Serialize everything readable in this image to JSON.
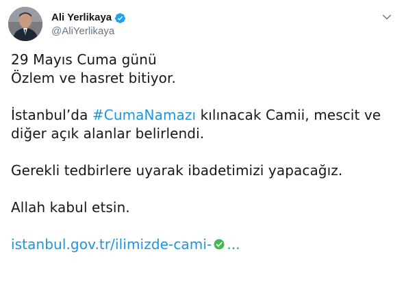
{
  "user": {
    "display_name": "Ali Yerlikaya",
    "handle": "@AliYerlikaya",
    "verified_icon": "verified-badge-icon"
  },
  "tweet": {
    "line1": "29 Mayıs Cuma günü",
    "line2": "Özlem ve hasret bitiyor.",
    "line3_pre": "İstanbul’da ",
    "line3_hashtag": "#CumaNamazı",
    "line3_post": " kılınacak Camii, mescit ve",
    "line4": "diğer açık alanlar belirlendi.",
    "line5": "Gerekli tedbirlere uyarak ibadetimizi yapacağız.",
    "line6": "Allah kabul etsin.",
    "link_text": "istanbul.gov.tr/ilimizde-cami-",
    "link_suffix": "..."
  },
  "colors": {
    "link": "#1b95e0",
    "verified": "#1da1f2",
    "check": "#3fba4f",
    "text": "#14171a",
    "muted": "#657786"
  }
}
